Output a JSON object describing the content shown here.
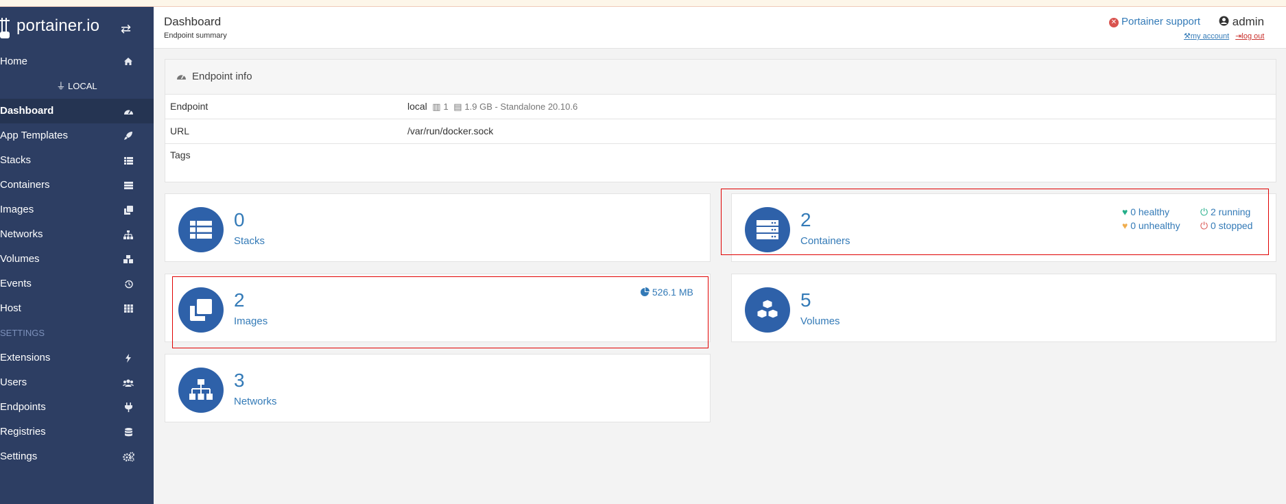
{
  "app": {
    "brand": "portainer.io"
  },
  "sidebar": {
    "home": "Home",
    "endpoint_name": "LOCAL",
    "items": [
      {
        "label": "Dashboard",
        "icon": "tachometer-icon"
      },
      {
        "label": "App Templates",
        "icon": "rocket-icon"
      },
      {
        "label": "Stacks",
        "icon": "th-list-icon"
      },
      {
        "label": "Containers",
        "icon": "server-icon"
      },
      {
        "label": "Images",
        "icon": "clone-icon"
      },
      {
        "label": "Networks",
        "icon": "sitemap-icon"
      },
      {
        "label": "Volumes",
        "icon": "cubes-icon"
      },
      {
        "label": "Events",
        "icon": "history-icon"
      },
      {
        "label": "Host",
        "icon": "th-icon"
      }
    ],
    "settings_heading": "SETTINGS",
    "settings_items": [
      {
        "label": "Extensions",
        "icon": "bolt-icon"
      },
      {
        "label": "Users",
        "icon": "users-icon"
      },
      {
        "label": "Endpoints",
        "icon": "plug-icon"
      },
      {
        "label": "Registries",
        "icon": "database-icon"
      },
      {
        "label": "Settings",
        "icon": "cogs-icon"
      }
    ]
  },
  "header": {
    "title": "Dashboard",
    "subtitle": "Endpoint summary",
    "support": "Portainer support",
    "user": "admin",
    "my_account": "my account",
    "log_out": "log out"
  },
  "endpoint_info": {
    "title": "Endpoint info",
    "rows": [
      {
        "key": "Endpoint",
        "value": "local",
        "cpu": "1",
        "memory": "1.9 GB - Standalone 20.10.6"
      },
      {
        "key": "URL",
        "value": "/var/run/docker.sock"
      },
      {
        "key": "Tags",
        "value": ""
      }
    ]
  },
  "tiles": {
    "stacks": {
      "count": "0",
      "label": "Stacks"
    },
    "containers": {
      "count": "2",
      "label": "Containers",
      "healthy": "0 healthy",
      "running": "2 running",
      "unhealthy": "0 unhealthy",
      "stopped": "0 stopped"
    },
    "images": {
      "count": "2",
      "label": "Images",
      "size": "526.1 MB"
    },
    "volumes": {
      "count": "5",
      "label": "Volumes"
    },
    "networks": {
      "count": "3",
      "label": "Networks"
    }
  },
  "colors": {
    "sidebar": "#2d3e63",
    "accent": "#2e61a9",
    "link": "#337ab7"
  }
}
